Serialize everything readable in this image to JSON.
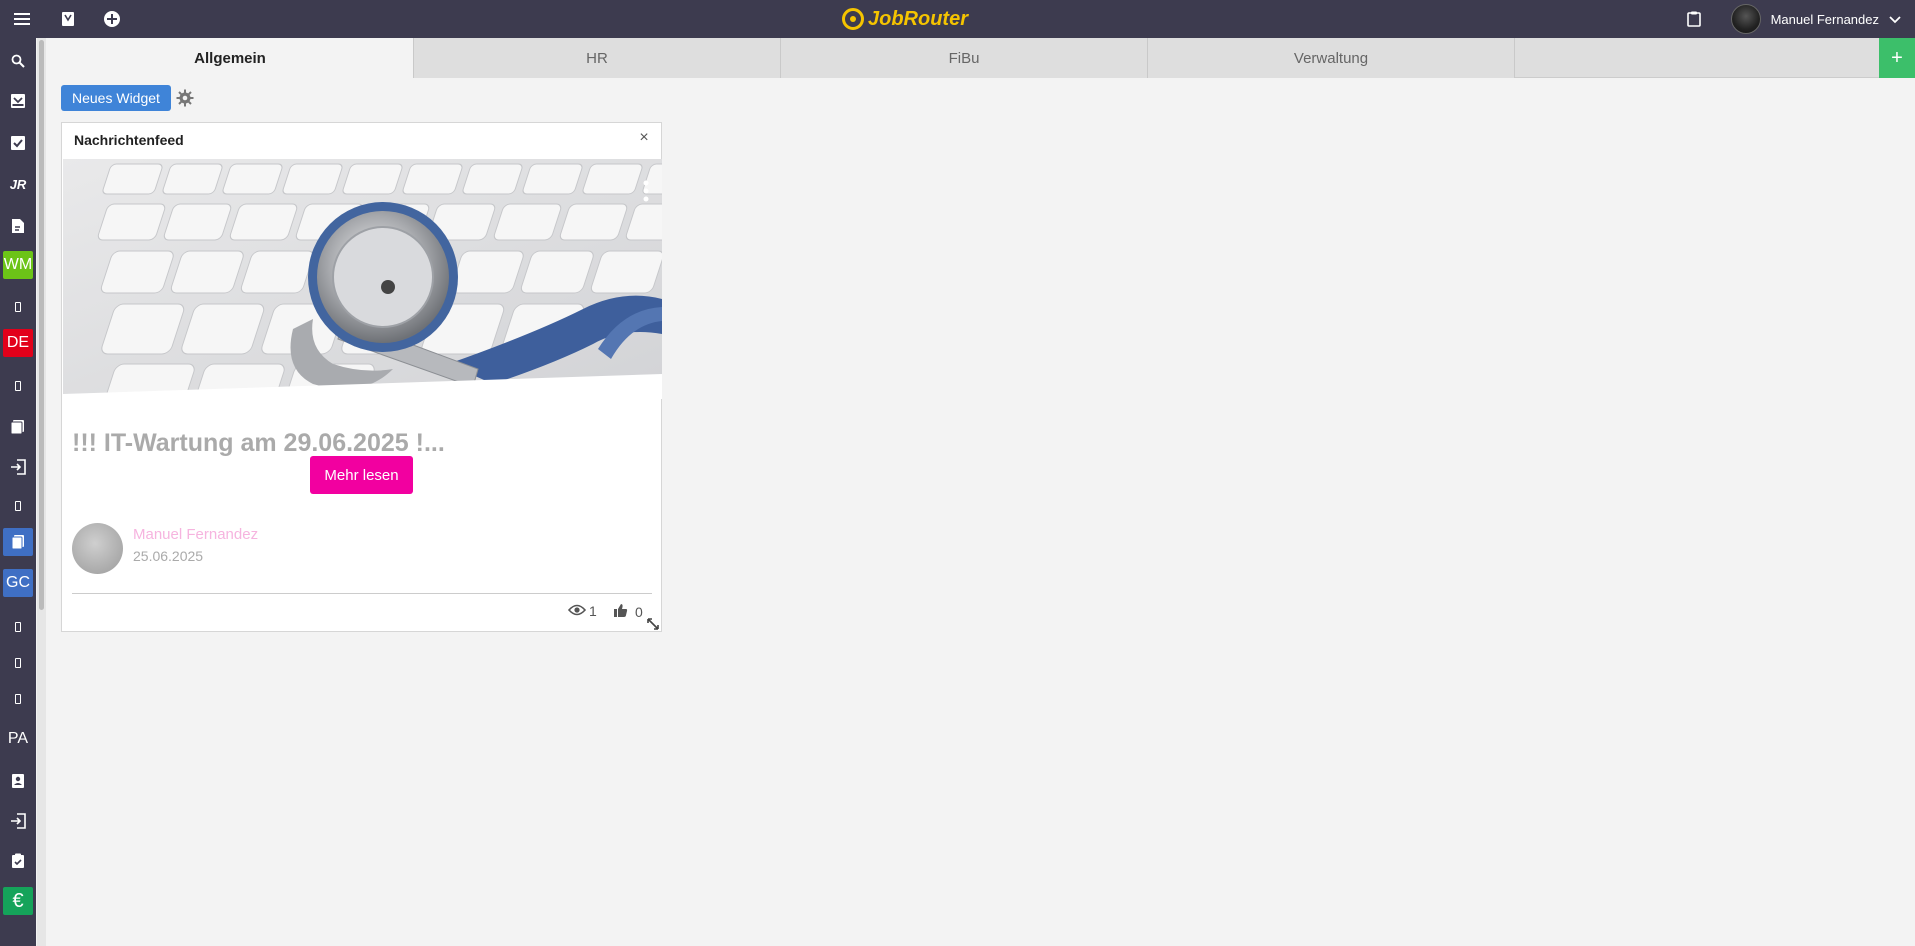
{
  "topbar": {
    "logo_text": "JobRouter",
    "user_name": "Manuel Fernandez"
  },
  "sidebar": {
    "tiles": [
      {
        "label": "WM",
        "color": "#6cc417"
      },
      {
        "label": "DE",
        "color": "#e2001a"
      },
      {
        "label": "GC",
        "color": "#3f6fc4"
      },
      {
        "label": "PA",
        "color": ""
      },
      {
        "label": "JR",
        "color": ""
      },
      {
        "label": "€",
        "color": "#15a35a"
      }
    ]
  },
  "tabs": [
    {
      "label": "Allgemein",
      "active": true
    },
    {
      "label": "HR",
      "active": false
    },
    {
      "label": "FiBu",
      "active": false
    },
    {
      "label": "Verwaltung",
      "active": false
    }
  ],
  "tab_add_label": "+",
  "toolbar": {
    "new_widget_label": "Neues Widget"
  },
  "widget": {
    "title": "Nachrichtenfeed",
    "close_glyph": "×",
    "news": {
      "title": "!!! IT-Wartung am 29.06.2025 !...",
      "read_more_label": "Mehr lesen",
      "author": "Manuel Fernandez",
      "date": "25.06.2025",
      "views": "1",
      "likes": "0"
    }
  },
  "colors": {
    "topbar": "#3d3b4f",
    "accent_blue": "#3f84d8",
    "accent_pink": "#f200a0",
    "accent_green": "#3cbf6a",
    "logo_yellow": "#f5c400"
  }
}
